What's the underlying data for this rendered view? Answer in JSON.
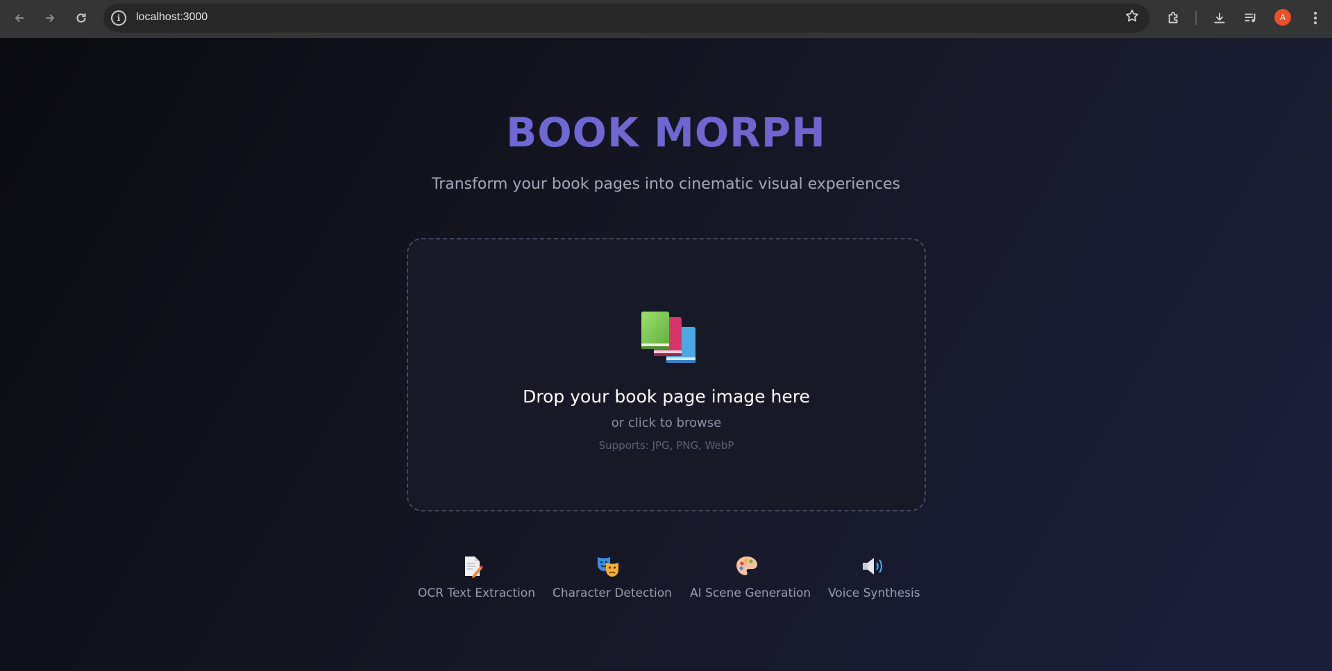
{
  "browser": {
    "url": "localhost:3000",
    "avatar_letter": "A",
    "icons": [
      "back-arrow-icon",
      "forward-arrow-icon",
      "reload-icon",
      "site-info-icon",
      "star-icon",
      "extensions-icon",
      "download-icon",
      "media-controls-icon",
      "menu-dots-icon"
    ]
  },
  "hero": {
    "title": "BOOK MORPH",
    "subtitle": "Transform your book pages into cinematic visual experiences"
  },
  "dropzone": {
    "icon": "books-icon",
    "title": "Drop your book page image here",
    "browse": "or click to browse",
    "supports": "Supports: JPG, PNG, WebP"
  },
  "features": [
    {
      "icon": "document-pencil-icon",
      "label": "OCR Text Extraction"
    },
    {
      "icon": "theater-masks-icon",
      "label": "Character Detection"
    },
    {
      "icon": "palette-icon",
      "label": "AI Scene Generation"
    },
    {
      "icon": "speaker-icon",
      "label": "Voice Synthesis"
    }
  ],
  "colors": {
    "accent_start": "#6670dc",
    "accent_end": "#7a5cc8",
    "avatar": "#e8502a"
  }
}
